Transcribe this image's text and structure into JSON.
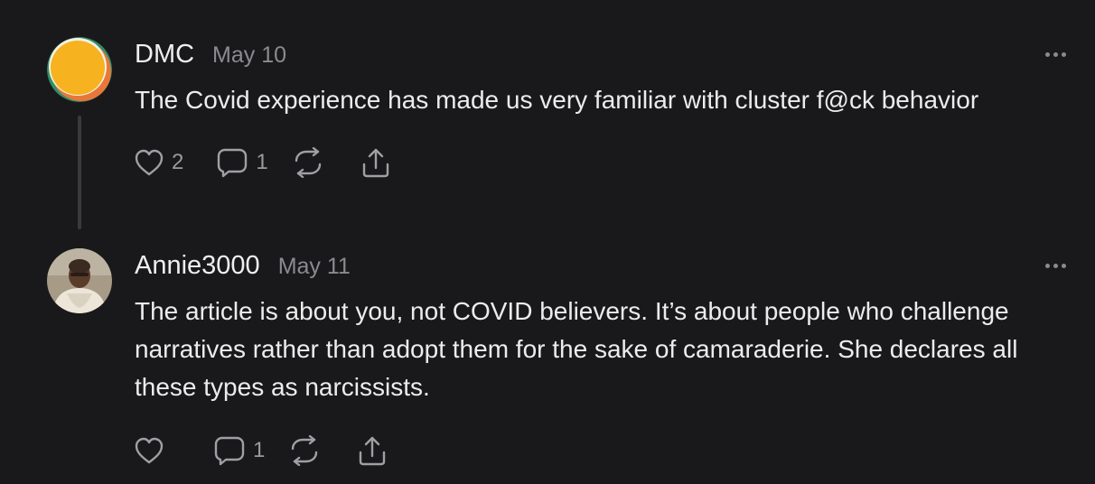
{
  "comments": [
    {
      "author": "DMC",
      "date": "May 10",
      "text": "The Covid experience has made us very familiar with cluster f@ck behavior",
      "likes": "2",
      "replies": "1"
    },
    {
      "author": "Annie3000",
      "date": "May 11",
      "text": "The article is about you, not COVID believers. It’s about people who challenge narratives rather than adopt them for the sake of camaraderie. She declares all these types as narcissists.",
      "replies": "1"
    }
  ],
  "icons": {
    "like": "heart-icon",
    "reply": "speech-bubble-icon",
    "restack": "repeat-icon",
    "share": "share-upload-icon",
    "more": "ellipsis-icon"
  },
  "colors": {
    "background": "#19191b",
    "text": "#ececec",
    "muted": "#8b8b8f",
    "thread_line": "#3a3a3c"
  }
}
